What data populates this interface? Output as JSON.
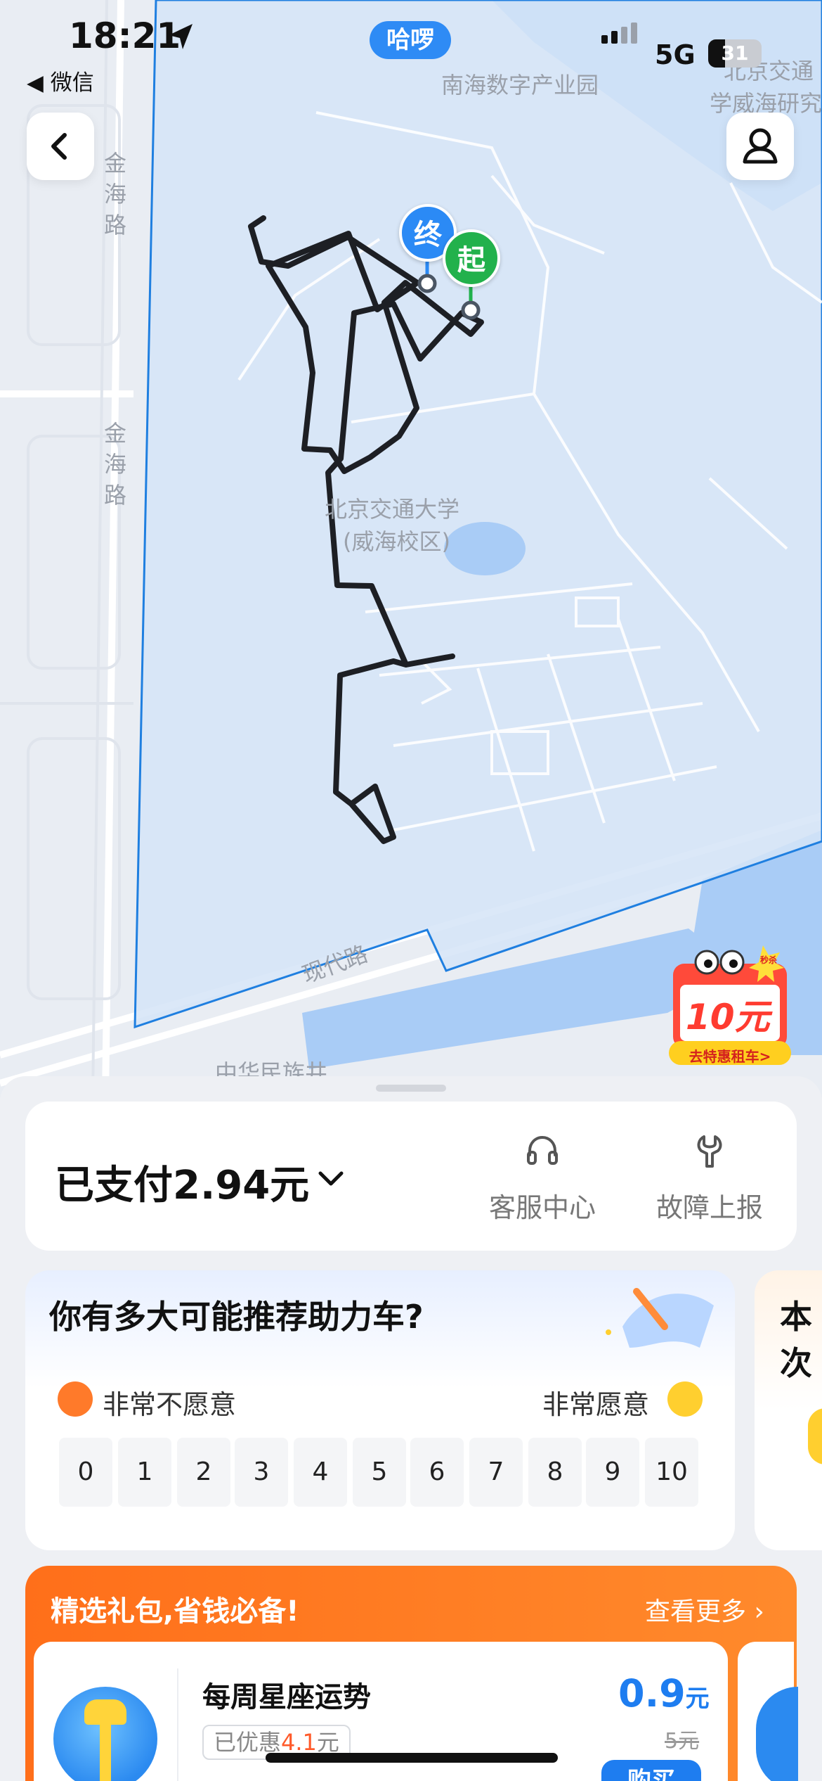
{
  "status_bar": {
    "time": "18:21",
    "back_app": "◀ 微信",
    "app_pill": "哈啰",
    "network": "5G",
    "battery": "31",
    "battery_level": 0.31
  },
  "map": {
    "labels": {
      "road_left_1": "金\n海\n路",
      "road_left_2": "金\n海\n路",
      "park": "南海数字产业园",
      "top_right_1": "北京交通",
      "top_right_2": "学威海研究",
      "campus_1": "北京交通大学",
      "campus_2": "(威海校区)",
      "road_bottom": "现代路",
      "bottom_cut": "中华民族井"
    },
    "pins": {
      "end": "终",
      "start": "起"
    },
    "colors": {
      "route": "#1d1f24",
      "fence": "#1f7fe0",
      "water": "#a9ccf6",
      "zone": "#d5e4f7",
      "pin_end": "#2b8af5",
      "pin_start": "#22b14c"
    },
    "promo": {
      "badge": "秒杀",
      "amount": "10元",
      "cta": "去特惠租车>"
    }
  },
  "payment": {
    "label": "已支付2.94元",
    "actions": [
      {
        "label": "客服中心",
        "icon": "headset-icon"
      },
      {
        "label": "故障上报",
        "icon": "wrench-icon"
      }
    ]
  },
  "nps": {
    "title": "你有多大可能推荐助力车?",
    "low_label": "非常不愿意",
    "high_label": "非常愿意",
    "scale": [
      "0",
      "1",
      "2",
      "3",
      "4",
      "5",
      "6",
      "7",
      "8",
      "9",
      "10"
    ],
    "peek_title": "本次"
  },
  "pack": {
    "title": "精选礼包,省钱必备!",
    "more": "查看更多",
    "deal": {
      "title": "每周星座运势",
      "tag_prefix": "已优惠",
      "tag_amount": "4.1",
      "tag_suffix": "元",
      "price": "0.9",
      "unit": "元",
      "original": "5元",
      "buy": "购买"
    }
  }
}
